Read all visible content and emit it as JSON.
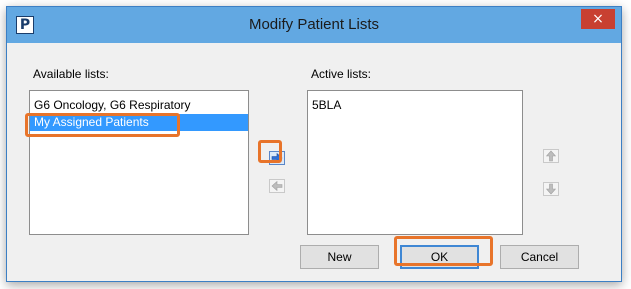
{
  "window": {
    "title": "Modify Patient Lists",
    "app_icon_letter": "P",
    "close_glyph": "×"
  },
  "available": {
    "label": "Available lists:",
    "items": [
      "G6 Oncology, G6 Respiratory",
      "My Assigned Patients"
    ],
    "selected_index": 1
  },
  "active": {
    "label": "Active lists:",
    "items": [
      "5BLA"
    ]
  },
  "transfer": {
    "add_icon": "arrow-right-icon",
    "remove_icon": "arrow-left-icon"
  },
  "reorder": {
    "up_icon": "arrow-up-icon",
    "down_icon": "arrow-down-icon"
  },
  "buttons": {
    "new_label": "New",
    "ok_label": "OK",
    "cancel_label": "Cancel"
  },
  "colors": {
    "highlight": "#e8742a",
    "selection": "#3399ff",
    "titlebar": "#62a8e2",
    "close": "#c84031"
  }
}
